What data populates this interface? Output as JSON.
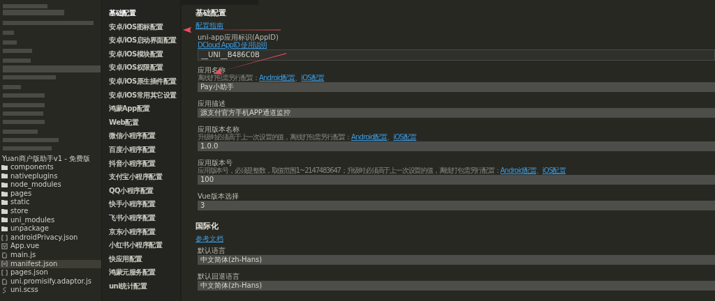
{
  "explorer": {
    "project": "Yuan商户版助手v1 - 免费版",
    "items": [
      {
        "name": "components",
        "kind": "folder",
        "selected": false
      },
      {
        "name": "nativeplugins",
        "kind": "folder",
        "selected": false
      },
      {
        "name": "node_modules",
        "kind": "folder",
        "selected": false
      },
      {
        "name": "pages",
        "kind": "folder",
        "selected": false
      },
      {
        "name": "static",
        "kind": "folder",
        "selected": false
      },
      {
        "name": "store",
        "kind": "folder",
        "selected": false
      },
      {
        "name": "uni_modules",
        "kind": "folder",
        "selected": false
      },
      {
        "name": "unpackage",
        "kind": "folder",
        "selected": false
      },
      {
        "name": "androidPrivacy.json",
        "kind": "json",
        "selected": false
      },
      {
        "name": "App.vue",
        "kind": "vue",
        "selected": false
      },
      {
        "name": "main.js",
        "kind": "js",
        "selected": false
      },
      {
        "name": "manifest.json",
        "kind": "manifest",
        "selected": true
      },
      {
        "name": "pages.json",
        "kind": "json",
        "selected": false
      },
      {
        "name": "uni.promisify.adaptor.js",
        "kind": "js",
        "selected": false
      },
      {
        "name": "uni.scss",
        "kind": "scss",
        "selected": false
      }
    ]
  },
  "menu": [
    {
      "label": "基础配置",
      "selected": true
    },
    {
      "label": "安卓/iOS图标配置",
      "selected": false
    },
    {
      "label": "安卓/iOS启动界面配置",
      "selected": false
    },
    {
      "label": "安卓/iOS模块配置",
      "selected": false
    },
    {
      "label": "安卓/iOS权限配置",
      "selected": false
    },
    {
      "label": "安卓/iOS原生插件配置",
      "selected": false
    },
    {
      "label": "安卓/iOS常用其它设置",
      "selected": false
    },
    {
      "label": "鸿蒙App配置",
      "selected": false
    },
    {
      "label": "Web配置",
      "selected": false
    },
    {
      "label": "微信小程序配置",
      "selected": false
    },
    {
      "label": "百度小程序配置",
      "selected": false
    },
    {
      "label": "抖音小程序配置",
      "selected": false
    },
    {
      "label": "支付宝小程序配置",
      "selected": false
    },
    {
      "label": "QQ小程序配置",
      "selected": false
    },
    {
      "label": "快手小程序配置",
      "selected": false
    },
    {
      "label": "飞书小程序配置",
      "selected": false
    },
    {
      "label": "京东小程序配置",
      "selected": false
    },
    {
      "label": "小红书小程序配置",
      "selected": false
    },
    {
      "label": "快应用配置",
      "selected": false
    },
    {
      "label": "鸿蒙元服务配置",
      "selected": false
    },
    {
      "label": "uni统计配置",
      "selected": false
    }
  ],
  "sections": [
    {
      "title": "基础配置",
      "link": "配置指南",
      "fields": [
        {
          "label": "uni-app应用标识(AppID)",
          "hint": [
            {
              "kind": "link",
              "text": "DCloud AppID 使用说明"
            }
          ],
          "value": "__UNI__B486C0B",
          "dark": true
        },
        {
          "label": "应用名称",
          "hint": [
            {
              "kind": "text",
              "text": "离线打包需另行配置："
            },
            {
              "kind": "link",
              "text": "Android配置"
            },
            {
              "kind": "text",
              "text": "、"
            },
            {
              "kind": "link",
              "text": "iOS配置"
            }
          ],
          "value": "Pay小助手",
          "dark": false
        },
        {
          "label": "应用描述",
          "value": "源支付官方手机APP通道监控",
          "dark": false
        },
        {
          "label": "应用版本名称",
          "hint": [
            {
              "kind": "text",
              "text": "升级时必须高于上一次设置的值，离线打包需另行配置："
            },
            {
              "kind": "link",
              "text": "Android配置"
            },
            {
              "kind": "text",
              "text": "、"
            },
            {
              "kind": "link",
              "text": "iOS配置"
            }
          ],
          "value": "1.0.0",
          "dark": false
        },
        {
          "label": "应用版本号",
          "hint": [
            {
              "kind": "text",
              "text": "应用版本号，必须是整数，取值范围1~2147483647；升级时必须高于上一次设置的值，离线打包需另行配置："
            },
            {
              "kind": "link",
              "text": "Android配置"
            },
            {
              "kind": "text",
              "text": "、"
            },
            {
              "kind": "link",
              "text": "iOS配置"
            }
          ],
          "value": "100",
          "dark": false
        },
        {
          "label": "Vue版本选择",
          "value": "3",
          "dark": false
        }
      ]
    },
    {
      "title": "国际化",
      "link": "参考文档",
      "fields": [
        {
          "label": "默认语言",
          "value": "中文简体(zh-Hans)",
          "dark": false
        },
        {
          "label": "默认回退语言",
          "value": "中文简体(zh-Hans)",
          "dark": false
        }
      ]
    }
  ]
}
